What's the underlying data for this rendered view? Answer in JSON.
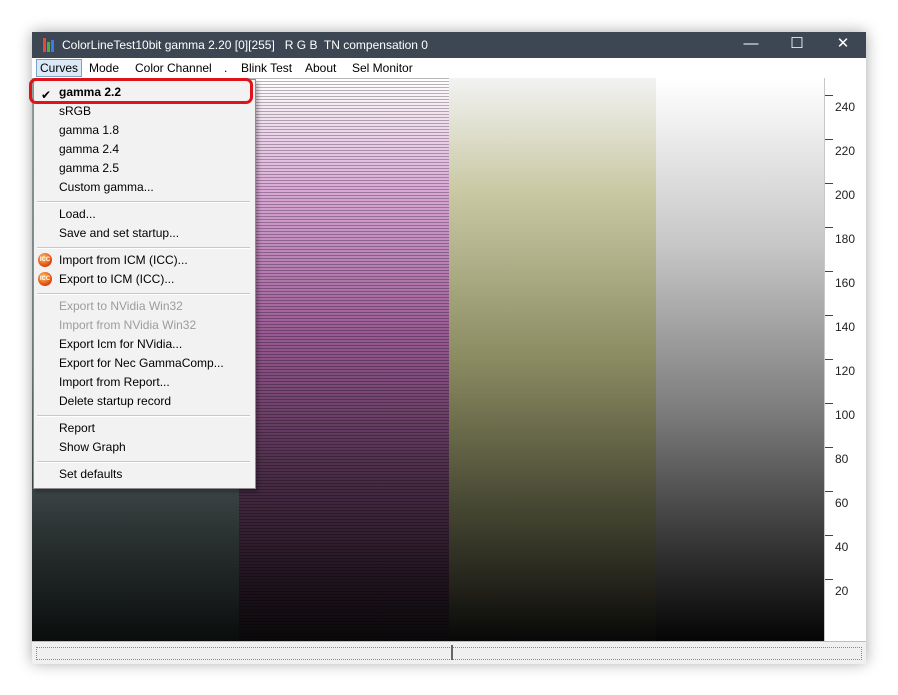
{
  "window": {
    "title": "ColorLineTest10bit gamma 2.20 [0][255]   R G B  TN compensation 0",
    "minimize": "—",
    "maximize": "☐",
    "close": "✕"
  },
  "menubar": {
    "items": [
      "Curves",
      "Mode",
      "Color Channel",
      ".",
      "Blink Test",
      "About",
      "Sel Monitor"
    ]
  },
  "curves_menu": {
    "checkmark": "✔",
    "icon_text": "ICC",
    "items": [
      "gamma 2.2",
      "sRGB",
      "gamma 1.8",
      "gamma 2.4",
      "gamma 2.5",
      "Custom gamma...",
      "Load...",
      "Save and set startup...",
      "Import from ICM (ICC)...",
      "Export to ICM (ICC)...",
      "Export to NVidia Win32",
      "Import from NVidia Win32",
      "Export Icm for NVidia...",
      "Export for Nec GammaComp...",
      "Import from Report...",
      "Delete startup record",
      "Report",
      "Show Graph",
      "Set defaults"
    ],
    "selected": "gamma 2.2",
    "disabled": [
      "Export to NVidia Win32",
      "Import from NVidia Win32"
    ]
  },
  "ruler": {
    "labels": [
      "240",
      "220",
      "200",
      "180",
      "160",
      "140",
      "120",
      "100",
      "80",
      "60",
      "40",
      "20"
    ]
  },
  "colors": {
    "titlebar": "#3d4653",
    "highlight": "#e0121a",
    "menu_bg": "#f2f2f2"
  }
}
